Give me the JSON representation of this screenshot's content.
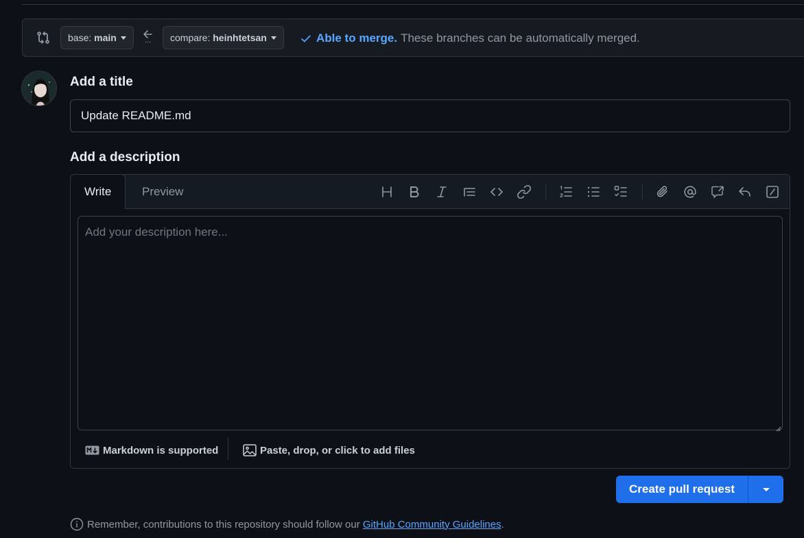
{
  "compare_bar": {
    "base_prefix": "base:",
    "base_branch": "main",
    "compare_prefix": "compare:",
    "compare_branch": "heinhtetsan",
    "merge_status": "Able to merge.",
    "merge_message": "These branches can be automatically merged.",
    "range_dots": "...",
    "status_color": "#58a6ff"
  },
  "form": {
    "title_label": "Add a title",
    "title_value": "Update README.md",
    "description_label": "Add a description",
    "description_placeholder": "Add your description here..."
  },
  "editor": {
    "tabs": [
      {
        "label": "Write",
        "active": true
      },
      {
        "label": "Preview",
        "active": false
      }
    ],
    "toolbar": [
      "heading-icon",
      "bold-icon",
      "italic-icon",
      "quote-icon",
      "code-icon",
      "link-icon",
      "numbered-list-icon",
      "bulleted-list-icon",
      "task-list-icon",
      "attach-icon",
      "mention-icon",
      "cross-reference-icon",
      "reply-icon",
      "slash-commands-icon"
    ],
    "markdown_note": "Markdown is supported",
    "files_note": "Paste, drop, or click to add files"
  },
  "actions": {
    "create_label": "Create pull request",
    "button_color": "#1f6feb"
  },
  "footer": {
    "note_prefix": "Remember, contributions to this repository should follow our",
    "note_link": "GitHub Community Guidelines",
    "note_suffix": "."
  }
}
